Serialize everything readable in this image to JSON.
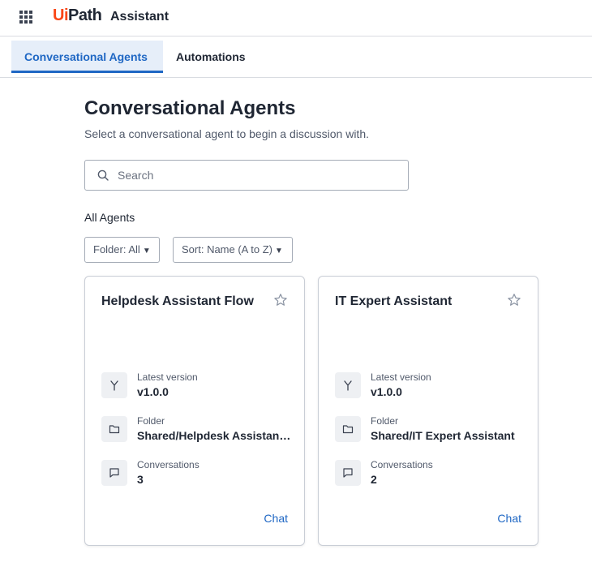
{
  "header": {
    "apps_icon": "grid-icon",
    "logo_prefix": "Ui",
    "logo_suffix": "Path",
    "app_name": "Assistant"
  },
  "tabs": [
    {
      "label": "Conversational Agents",
      "active": true
    },
    {
      "label": "Automations",
      "active": false
    }
  ],
  "main": {
    "title": "Conversational Agents",
    "subtitle": "Select a conversational agent to begin a discussion with.",
    "search": {
      "placeholder": "Search",
      "value": "",
      "icon": "search-icon"
    },
    "section_label": "All Agents",
    "filters": {
      "folder": {
        "label": "Folder: All",
        "icon": "caret-down-icon"
      },
      "sort": {
        "label": "Sort: Name (A to Z)",
        "icon": "caret-down-icon"
      }
    }
  },
  "agents": [
    {
      "title": "Helpdesk Assistant Flow",
      "version_label": "Latest version",
      "version": "v1.0.0",
      "folder_label": "Folder",
      "folder": "Shared/Helpdesk Assistant Flow",
      "conversations_label": "Conversations",
      "conversations": "3",
      "action": "Chat"
    },
    {
      "title": "IT Expert Assistant",
      "version_label": "Latest version",
      "version": "v1.0.0",
      "folder_label": "Folder",
      "folder": "Shared/IT Expert Assistant",
      "conversations_label": "Conversations",
      "conversations": "2",
      "action": "Chat"
    }
  ],
  "colors": {
    "accent": "#1f67c4",
    "brand": "#fa4616",
    "active_tab_bg": "#e6eef9"
  }
}
